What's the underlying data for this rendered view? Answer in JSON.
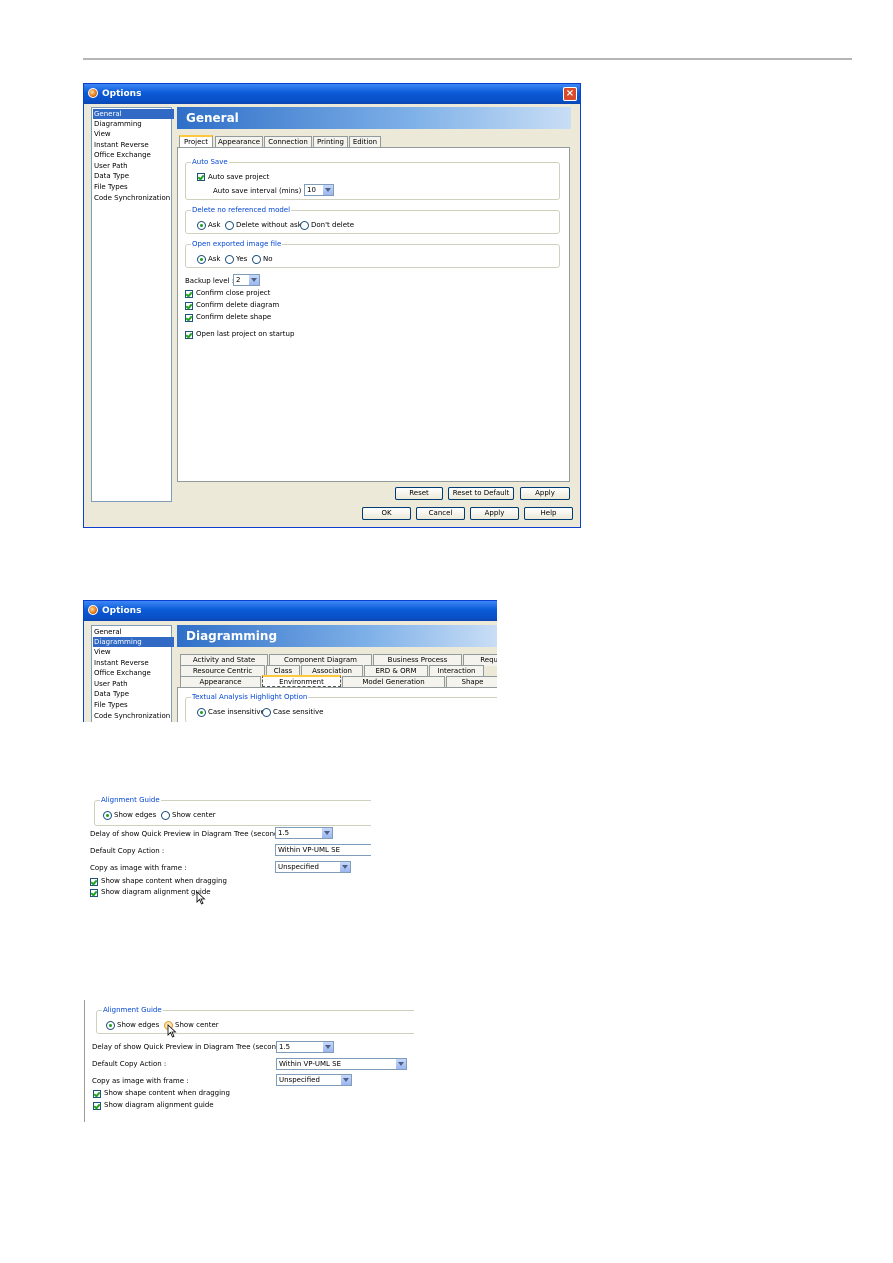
{
  "options_dialog_1": {
    "title": "Options",
    "categories": [
      "General",
      "Diagramming",
      "View",
      "Instant Reverse",
      "Office Exchange",
      "User Path",
      "Data Type",
      "File Types",
      "Code Synchronization"
    ],
    "selected_category": "General",
    "header": "General",
    "tabs": [
      "Project",
      "Appearance",
      "Connection",
      "Printing",
      "Edition"
    ],
    "active_tab": "Project",
    "auto_save": {
      "legend": "Auto Save",
      "auto_save_project_label": "Auto save project",
      "auto_save_project_checked": true,
      "interval_label": "Auto save interval (mins) :",
      "interval_value": "10"
    },
    "delete_model": {
      "legend": "Delete no referenced model",
      "options": [
        "Ask",
        "Delete without ask",
        "Don't delete"
      ],
      "selected": "Ask"
    },
    "open_image": {
      "legend": "Open exported image file",
      "options": [
        "Ask",
        "Yes",
        "No"
      ],
      "selected": "Ask"
    },
    "backup_level_label": "Backup level :",
    "backup_level_value": "2",
    "checkboxes": [
      {
        "label": "Confirm close project",
        "checked": true
      },
      {
        "label": "Confirm delete diagram",
        "checked": true
      },
      {
        "label": "Confirm delete shape",
        "checked": true
      },
      {
        "label": "Open last project on startup",
        "checked": true
      }
    ],
    "panel_buttons": [
      "Reset",
      "Reset to Default",
      "Apply"
    ],
    "dialog_buttons": [
      "OK",
      "Cancel",
      "Apply",
      "Help"
    ]
  },
  "options_dialog_2": {
    "title": "Options",
    "categories": [
      "General",
      "Diagramming",
      "View",
      "Instant Reverse",
      "Office Exchange",
      "User Path",
      "Data Type",
      "File Types",
      "Code Synchronization"
    ],
    "selected_category": "Diagramming",
    "header": "Diagramming",
    "tab_row_1": [
      "Activity and State",
      "Component Diagram",
      "Business Process",
      "Requ"
    ],
    "tab_row_2": [
      "Resource Centric",
      "Class",
      "Association",
      "ERD & ORM",
      "Interaction"
    ],
    "tab_row_3": [
      "Appearance",
      "Environment",
      "Model Generation",
      "Shape"
    ],
    "active_tab": "Environment",
    "textual_analysis": {
      "legend": "Textual Analysis Highlight Option",
      "options": [
        "Case insensitive",
        "Case sensitive"
      ],
      "selected": "Case insensitive"
    }
  },
  "environment_snippet_1": {
    "alignment_legend": "Alignment Guide",
    "alignment_options": [
      "Show edges",
      "Show center"
    ],
    "alignment_selected": "Show edges",
    "delay_label": "Delay of show Quick Preview in Diagram Tree (second) :",
    "delay_value": "1.5",
    "copy_action_label": "Default Copy Action :",
    "copy_action_value": "Within VP-UML SE",
    "copy_frame_label": "Copy as image with frame :",
    "copy_frame_value": "Unspecified",
    "show_shape_content_label": "Show shape content when dragging",
    "show_shape_content_checked": true,
    "show_alignment_guide_label": "Show diagram alignment guide",
    "show_alignment_guide_checked": true
  },
  "environment_snippet_2": {
    "alignment_legend": "Alignment Guide",
    "alignment_options": [
      "Show edges",
      "Show center"
    ],
    "alignment_selected": "Show edges",
    "delay_label": "Delay of show Quick Preview in Diagram Tree (second) :",
    "delay_value": "1.5",
    "copy_action_label": "Default Copy Action :",
    "copy_action_value": "Within VP-UML SE",
    "copy_frame_label": "Copy as image with frame :",
    "copy_frame_value": "Unspecified",
    "show_shape_content_label": "Show shape content when dragging",
    "show_shape_content_checked": true,
    "show_alignment_guide_label": "Show diagram alignment guide",
    "show_alignment_guide_checked": true
  },
  "colors": {
    "titlebar": "#0a5ad6",
    "selection": "#316ac5",
    "legend_text": "#0046d5",
    "dialog_bg": "#ece9d8"
  }
}
